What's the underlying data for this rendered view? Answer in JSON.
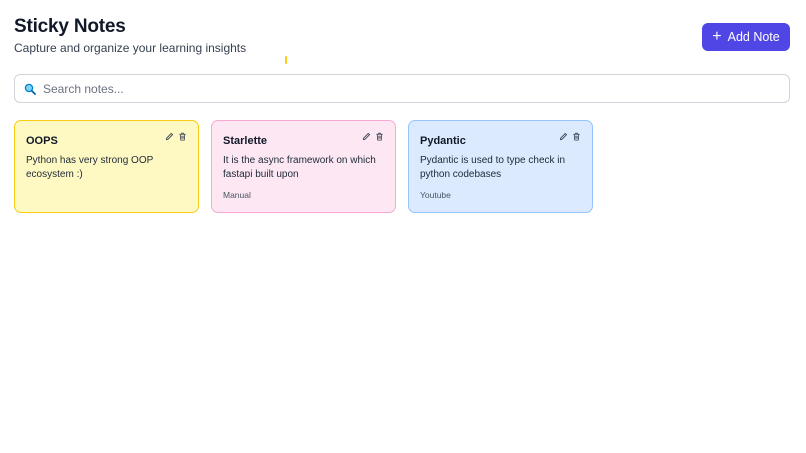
{
  "header": {
    "title": "Sticky Notes",
    "subtitle": "Capture and organize your learning insights",
    "add_button_label": "Add Note",
    "add_button_icon": "plus-icon"
  },
  "search": {
    "placeholder": "Search notes...",
    "value": "",
    "icon": "search-icon"
  },
  "notes": [
    {
      "title": "OOPS",
      "content": "Python has very strong OOP ecosystem :)",
      "source": "",
      "color": "#fef9c3",
      "border_color": "#facc15"
    },
    {
      "title": "Starlette",
      "content": "It is the async framework on which fastapi built upon",
      "source": "Manual",
      "color": "#fce7f3",
      "border_color": "#f9a8d4"
    },
    {
      "title": "Pydantic",
      "content": "Pydantic is used to type check in python codebases",
      "source": "Youtube",
      "color": "#dbeafe",
      "border_color": "#93c5fd"
    }
  ],
  "colors": {
    "accent": "#4f46e5",
    "text": "#111827"
  }
}
